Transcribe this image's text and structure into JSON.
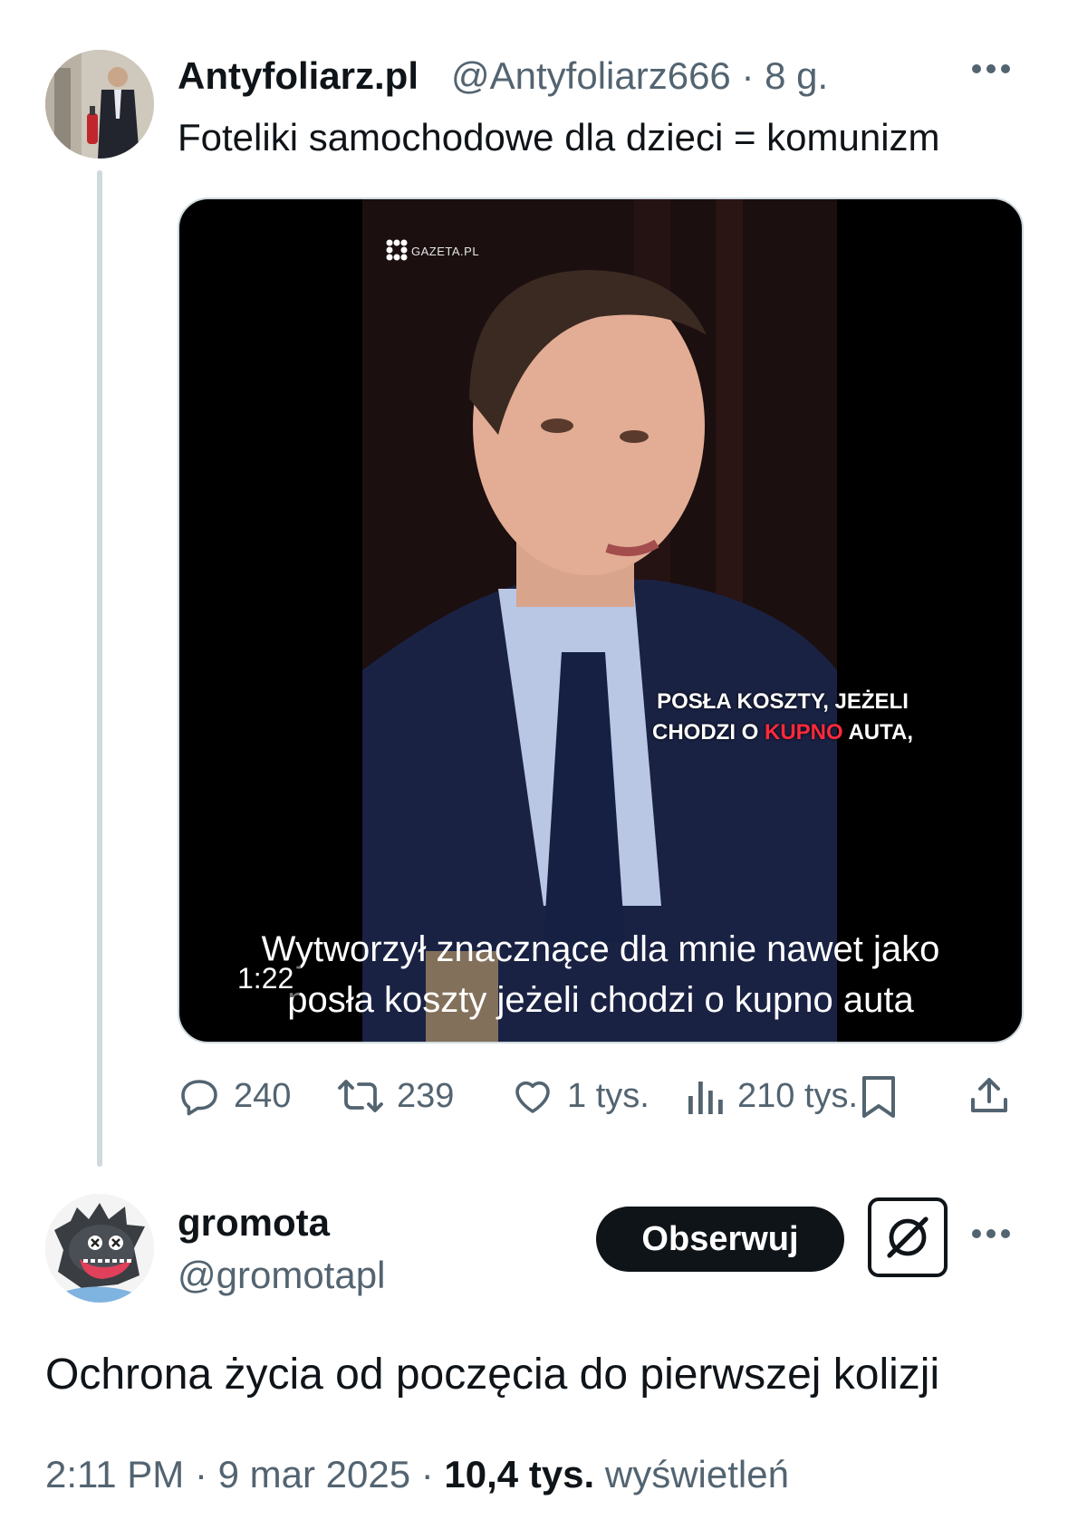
{
  "tweet1": {
    "display_name": "Antyfoliarz.pl",
    "handle": "@Antyfoliarz666",
    "separator": "·",
    "time": "8 g.",
    "more_icon": "more-dots-icon",
    "text": "Foteliki samochodowe dla dzieci = komunizm",
    "media": {
      "watermark": "GAZETA.PL",
      "burned_caption_line1": "POSŁA KOSZTY, JEŻELI",
      "burned_caption_line2_pre": "CHODZI O ",
      "burned_caption_line2_hl": "KUPNO",
      "burned_caption_line2_post": " AUTA,",
      "subtitle_line1": "Wytworzył znacznące dla mnie nawet jako",
      "subtitle_line2": "posła koszty jeżeli chodzi o kupno auta",
      "duration": "1:22"
    },
    "actions": {
      "replies": "240",
      "reposts": "239",
      "likes": "1 tys.",
      "views": "210 tys."
    }
  },
  "tweet2": {
    "display_name": "gromota",
    "handle": "@gromotapl",
    "follow_label": "Obserwuj",
    "text": "Ochrona życia od poczęcia do pierwszej kolizji",
    "time": "2:11 PM",
    "date": "9 mar 2025",
    "views_count": "10,4 tys.",
    "views_label": "wyświetleń"
  },
  "colors": {
    "text_primary": "#0f1419",
    "text_secondary": "#536471",
    "border": "#cfd9de",
    "caption_highlight": "#ff2a3c"
  }
}
